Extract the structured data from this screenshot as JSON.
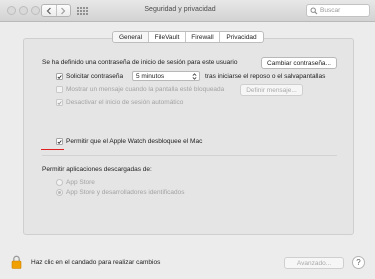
{
  "window": {
    "title": "Seguridad y privacidad"
  },
  "toolbar": {
    "back_icon": "chevron-left-icon",
    "forward_icon": "chevron-right-icon",
    "grid_icon": "grid-icon",
    "search_placeholder": "Buscar"
  },
  "tabs": [
    {
      "label": "General",
      "selected": true
    },
    {
      "label": "FileVault",
      "selected": false
    },
    {
      "label": "Firewall",
      "selected": false
    },
    {
      "label": "Privacidad",
      "selected": false
    }
  ],
  "general": {
    "password_set_text": "Se ha definido una contraseña de inicio de sesión para este usuario",
    "change_password_button": "Cambiar contraseña...",
    "require_password": {
      "label": "Solicitar contraseña",
      "checked": true,
      "delay_value": "5 minutos",
      "suffix": "tras iniciarse el reposo o el salvapantallas"
    },
    "show_message": {
      "label": "Mostrar un mensaje cuando la pantalla esté bloqueada",
      "checked": false,
      "enabled": false,
      "button": "Definir mensaje..."
    },
    "disable_autologin": {
      "label": "Desactivar el inicio de sesión automático",
      "checked": true,
      "enabled": false
    },
    "apple_watch_unlock": {
      "label": "Permitir que el Apple Watch desbloquee el Mac",
      "checked": true
    },
    "annotation_color": "#e02020",
    "downloads": {
      "heading": "Permitir aplicaciones descargadas de:",
      "options": [
        {
          "label": "App Store",
          "selected": false
        },
        {
          "label": "App Store y desarrolladores identificados",
          "selected": true
        }
      ]
    }
  },
  "footer": {
    "lock_text": "Haz clic en el candado para realizar cambios",
    "advanced_button": "Avanzado...",
    "help_label": "?"
  }
}
